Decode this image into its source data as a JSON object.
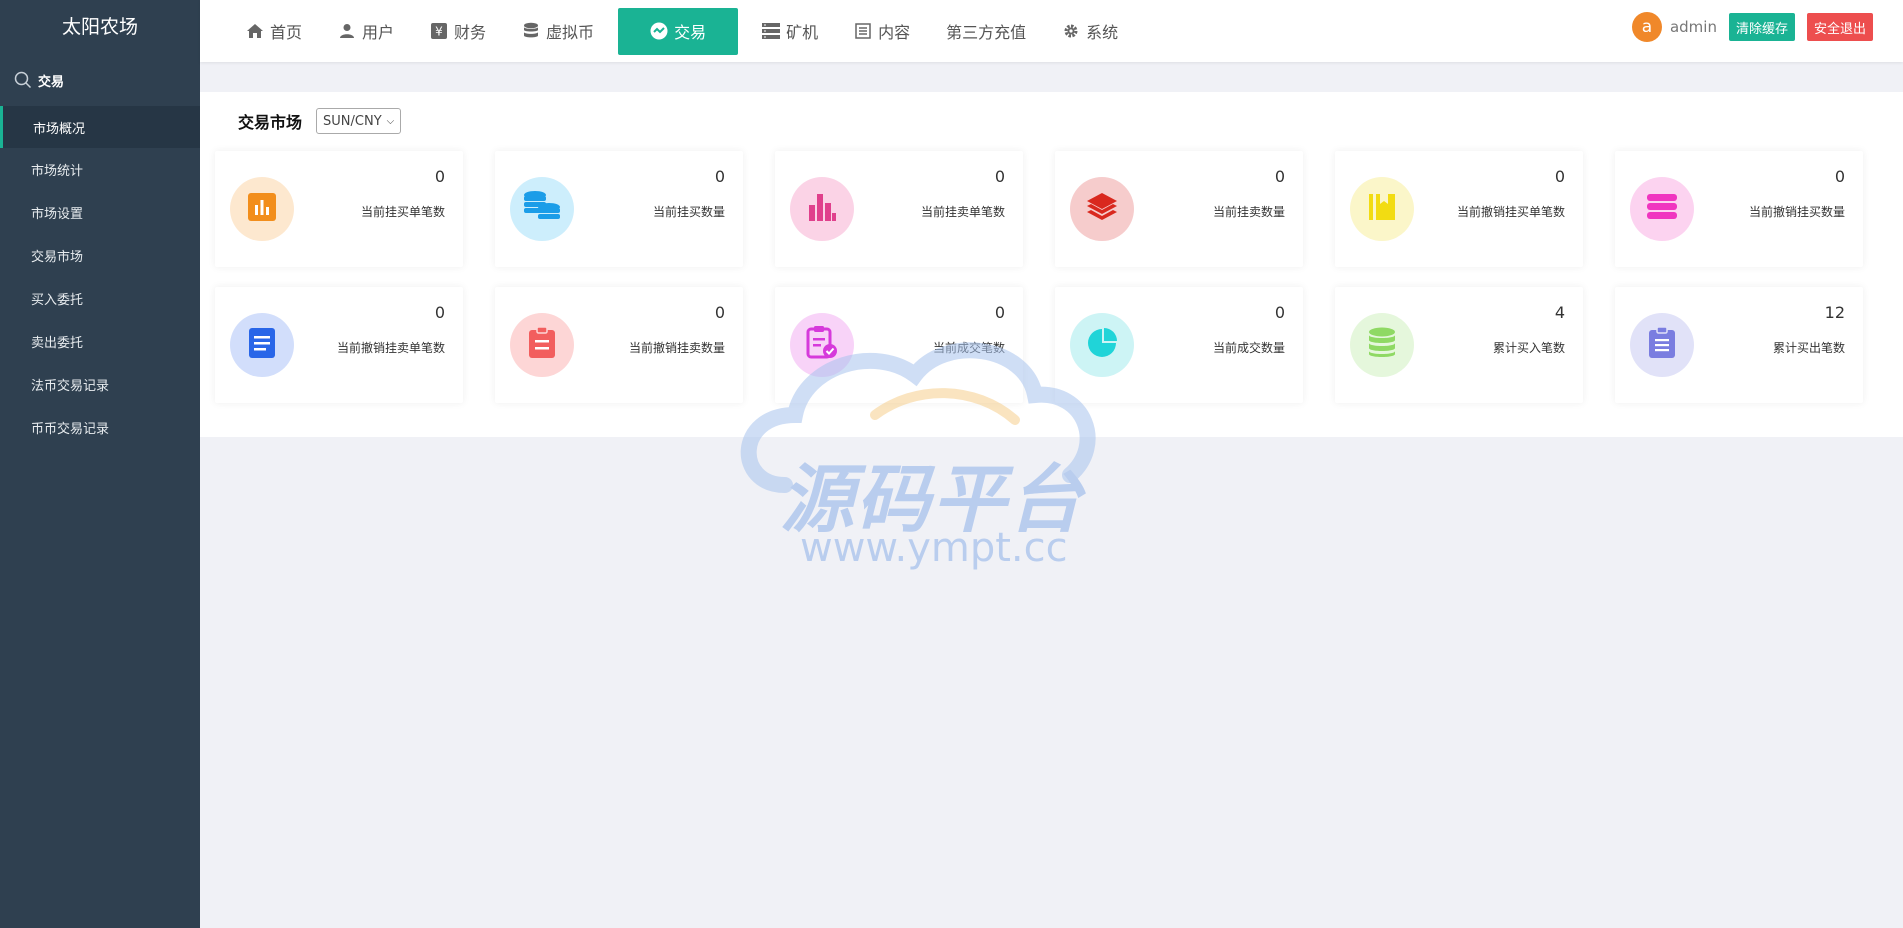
{
  "brand": "太阳农场",
  "sidebar": {
    "section_label": "交易",
    "items": [
      {
        "label": "市场概况"
      },
      {
        "label": "市场统计"
      },
      {
        "label": "市场设置"
      },
      {
        "label": "交易市场"
      },
      {
        "label": "买入委托"
      },
      {
        "label": "卖出委托"
      },
      {
        "label": "法币交易记录"
      },
      {
        "label": "币币交易记录"
      }
    ]
  },
  "nav": {
    "items": [
      {
        "label": "首页",
        "icon": "home-icon"
      },
      {
        "label": "用户",
        "icon": "user-icon"
      },
      {
        "label": "财务",
        "icon": "yen-icon"
      },
      {
        "label": "虚拟币",
        "icon": "database-icon"
      },
      {
        "label": "交易",
        "icon": "exchange-icon"
      },
      {
        "label": "矿机",
        "icon": "server-icon"
      },
      {
        "label": "内容",
        "icon": "list-icon"
      },
      {
        "label": "第三方充值",
        "icon": ""
      },
      {
        "label": "系统",
        "icon": "gear-icon"
      }
    ],
    "avatar_letter": "a",
    "username": "admin",
    "clear_cache": "清除缓存",
    "logout": "安全退出"
  },
  "market": {
    "title": "交易市场",
    "pair_selected": "SUN/CNY"
  },
  "stats": [
    {
      "value": "0",
      "label": "当前挂买单笔数",
      "color": "#f28e1c",
      "bg": "#fde8cf",
      "icon": "bar-chart-icon"
    },
    {
      "value": "0",
      "label": "当前挂买数量",
      "color": "#1b9de8",
      "bg": "#cdeefc",
      "icon": "coins-icon"
    },
    {
      "value": "0",
      "label": "当前挂卖单笔数",
      "color": "#e0408c",
      "bg": "#fbd3e6",
      "icon": "histogram-icon"
    },
    {
      "value": "0",
      "label": "当前挂卖数量",
      "color": "#d9281e",
      "bg": "#f6cccc",
      "icon": "layers-icon"
    },
    {
      "value": "0",
      "label": "当前撤销挂买单笔数",
      "color": "#f2dc12",
      "bg": "#fbf6c9",
      "icon": "book-icon"
    },
    {
      "value": "0",
      "label": "当前撤销挂买数量",
      "color": "#f035c0",
      "bg": "#fcd3f0",
      "icon": "stack-icon"
    },
    {
      "value": "0",
      "label": "当前撤销挂卖单笔数",
      "color": "#2966e8",
      "bg": "#d2defb",
      "icon": "document-icon"
    },
    {
      "value": "0",
      "label": "当前撤销挂卖数量",
      "color": "#f25e5e",
      "bg": "#fdd6d6",
      "icon": "clipboard-icon"
    },
    {
      "value": "0",
      "label": "当前成交笔数",
      "color": "#d63adb",
      "bg": "#f8d3f8",
      "icon": "clipboard-check-icon"
    },
    {
      "value": "0",
      "label": "当前成交数量",
      "color": "#20d4d8",
      "bg": "#cdf4f5",
      "icon": "pie-chart-icon"
    },
    {
      "value": "4",
      "label": "累计买入笔数",
      "color": "#8fd964",
      "bg": "#e5f7dc",
      "icon": "database-icon"
    },
    {
      "value": "12",
      "label": "累计买出笔数",
      "color": "#7a7de0",
      "bg": "#e1e2f8",
      "icon": "clipboard-list-icon"
    }
  ],
  "watermark": {
    "text": "源码平台",
    "url": "www.ympt.cc"
  }
}
